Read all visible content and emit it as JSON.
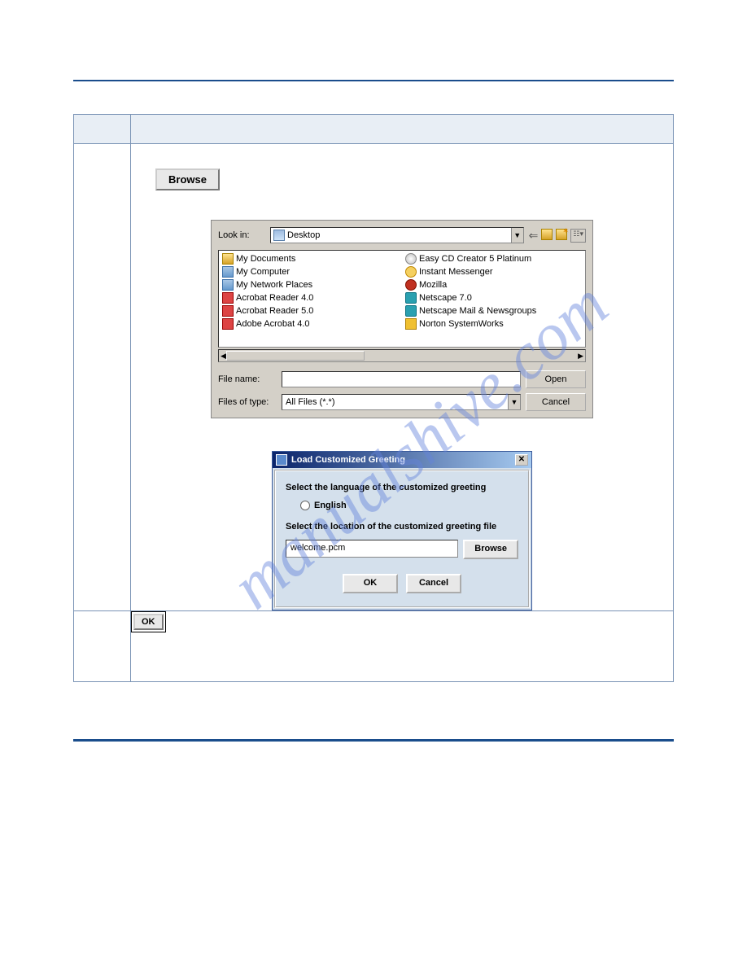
{
  "watermark": "manualshive.com",
  "browse_button_top": "Browse",
  "file_dialog": {
    "lookin_label": "Look in:",
    "lookin_value": "Desktop",
    "filename_label": "File name:",
    "filename_value": "",
    "filetype_label": "Files of type:",
    "filetype_value": "All Files (*.*)",
    "open_btn": "Open",
    "cancel_btn": "Cancel",
    "left_items": [
      "My Documents",
      "My Computer",
      "My Network Places",
      "Acrobat Reader 4.0",
      "Acrobat Reader 5.0",
      "Adobe Acrobat 4.0"
    ],
    "right_items": [
      "Easy CD Creator 5 Platinum",
      "Instant Messenger",
      "Mozilla",
      "Netscape 7.0",
      "Netscape Mail & Newsgroups",
      "Norton SystemWorks"
    ]
  },
  "custom_dialog": {
    "title": "Load Customized Greeting",
    "lang_prompt": "Select the language of the customized greeting",
    "lang_option": "English",
    "loc_prompt": "Select the location of the customized greeting file",
    "loc_value": "welcome.pcm",
    "browse_btn": "Browse",
    "ok_btn": "OK",
    "cancel_btn": "Cancel"
  },
  "step2_ok_btn": "OK"
}
